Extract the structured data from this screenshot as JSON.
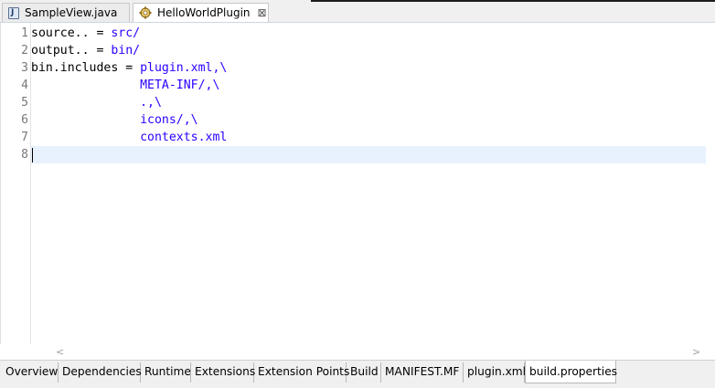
{
  "editor_tabs": [
    {
      "label": "SampleView.java",
      "icon": "java-file-icon"
    },
    {
      "label": "HelloWorldPlugin",
      "icon": "plugin-icon",
      "close": "⊠"
    }
  ],
  "code": {
    "lines": [
      {
        "number": "1",
        "key": "source.. = ",
        "value": "src/"
      },
      {
        "number": "2",
        "key": "output.. = ",
        "value": "bin/"
      },
      {
        "number": "3",
        "key": "bin.includes = ",
        "value": "plugin.xml,\\"
      },
      {
        "number": "4",
        "key": "               ",
        "value": "META-INF/,\\"
      },
      {
        "number": "5",
        "key": "               ",
        "value": ".,\\"
      },
      {
        "number": "6",
        "key": "               ",
        "value": "icons/,\\"
      },
      {
        "number": "7",
        "key": "               ",
        "value": "contexts.xml"
      },
      {
        "number": "8",
        "key": "",
        "value": ""
      }
    ]
  },
  "scroll": {
    "left_arrow": "<",
    "right_arrow": ">"
  },
  "page_tabs": [
    {
      "label": "Overview"
    },
    {
      "label": "Dependencies"
    },
    {
      "label": "Runtime"
    },
    {
      "label": "Extensions"
    },
    {
      "label": "Extension Points"
    },
    {
      "label": "Build"
    },
    {
      "label": "MANIFEST.MF"
    },
    {
      "label": "plugin.xml"
    },
    {
      "label": "build.properties"
    }
  ],
  "colors": {
    "value": "#2a00ff",
    "current_line": "#e8f2fe"
  }
}
